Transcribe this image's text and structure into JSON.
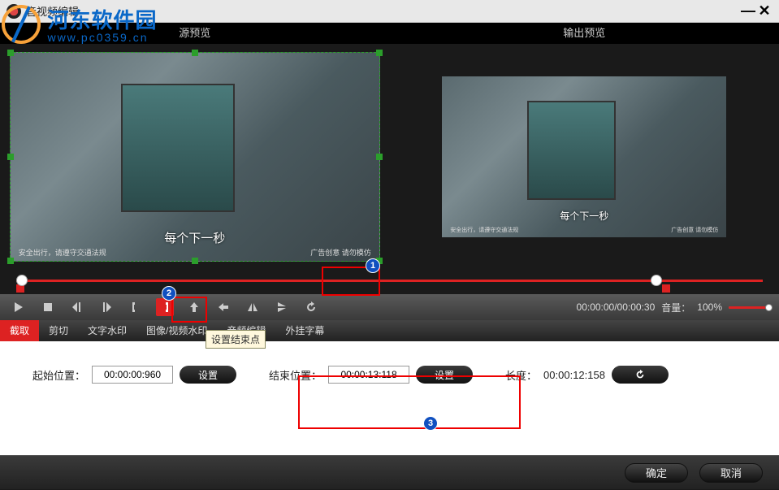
{
  "window": {
    "title": "音视频编辑"
  },
  "watermark": {
    "line1": "河东软件园",
    "line2": "www.pc0359.cn"
  },
  "preview": {
    "source_label": "源预览",
    "output_label": "输出预览",
    "caption": "每个下一秒",
    "subtext_left": "安全出行，请遵守交通法规",
    "subtext_right": "广告创意 请勿模仿"
  },
  "controls": {
    "time_display": "00:00:00/00:00:30",
    "volume_label": "音量：",
    "volume_value": "100%"
  },
  "tabs": [
    {
      "id": "trim",
      "label": "截取",
      "active": true
    },
    {
      "id": "crop",
      "label": "剪切",
      "active": false
    },
    {
      "id": "text",
      "label": "文字水印",
      "active": false
    },
    {
      "id": "image",
      "label": "图像/视频水印",
      "active": false
    },
    {
      "id": "audio",
      "label": "音频编辑",
      "active": false
    },
    {
      "id": "subtitle",
      "label": "外挂字幕",
      "active": false
    }
  ],
  "tooltip": "设置结束点",
  "trim_panel": {
    "start_label": "起始位置：",
    "start_value": "00:00:00:960",
    "start_button": "设置",
    "end_label": "结束位置：",
    "end_value": "00:00:13:118",
    "end_button": "设置",
    "length_label": "长度：",
    "length_value": "00:00:12:158"
  },
  "bottom": {
    "ok": "确定",
    "cancel": "取消"
  },
  "callouts": {
    "b1": "1",
    "b2": "2",
    "b3": "3"
  }
}
